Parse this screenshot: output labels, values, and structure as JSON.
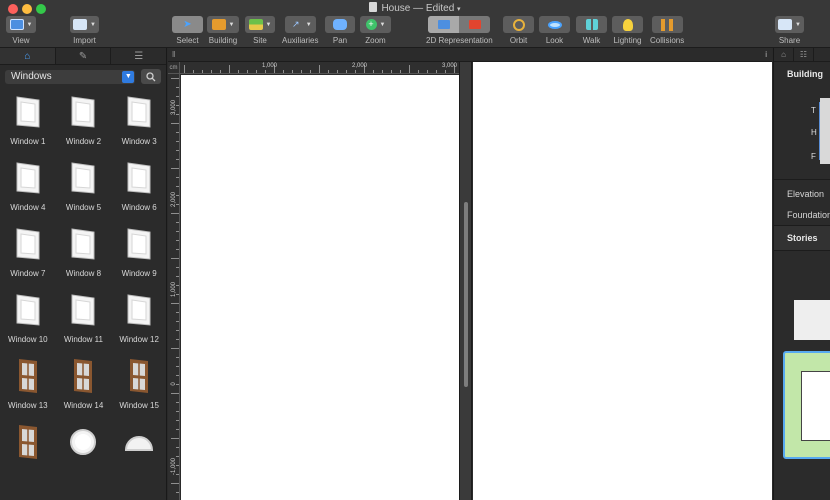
{
  "app": {
    "title": "House — Edited",
    "colors": {
      "close": "#fc605c",
      "minimize": "#fdbc40",
      "zoom": "#34c84a",
      "accent": "#2f7be0",
      "selection": "#57a9f0"
    }
  },
  "toolbar": {
    "view_label": "View",
    "import_label": "Import",
    "select_label": "Select",
    "building_label": "Building",
    "site_label": "Site",
    "auxiliaries_label": "Auxiliaries",
    "pan_label": "Pan",
    "zoom_label": "Zoom",
    "representation_label": "2D Representation",
    "orbit_label": "Orbit",
    "look_label": "Look",
    "walk_label": "Walk",
    "lighting_label": "Lighting",
    "collisions_label": "Collisions",
    "share_label": "Share"
  },
  "library": {
    "category": "Windows",
    "items": [
      {
        "label": "Window 1",
        "icon": "window-icon"
      },
      {
        "label": "Window 2",
        "icon": "window-icon"
      },
      {
        "label": "Window 3",
        "icon": "window-icon"
      },
      {
        "label": "Window 4",
        "icon": "window-icon"
      },
      {
        "label": "Window 5",
        "icon": "window-icon"
      },
      {
        "label": "Window 6",
        "icon": "window-icon"
      },
      {
        "label": "Window 7",
        "icon": "window-icon"
      },
      {
        "label": "Window 8",
        "icon": "window-icon"
      },
      {
        "label": "Window 9",
        "icon": "window-icon"
      },
      {
        "label": "Window 10",
        "icon": "window-icon"
      },
      {
        "label": "Window 11",
        "icon": "window-icon"
      },
      {
        "label": "Window 12",
        "icon": "window-icon"
      },
      {
        "label": "Window 13",
        "icon": "wood-window-icon"
      },
      {
        "label": "Window 14",
        "icon": "wood-window-icon"
      },
      {
        "label": "Window 15",
        "icon": "wood-window-icon"
      },
      {
        "label": "",
        "icon": "wood-window-icon"
      },
      {
        "label": "",
        "icon": "round-window-icon"
      },
      {
        "label": "",
        "icon": "half-round-window-icon"
      }
    ]
  },
  "ruler": {
    "unit": "cm",
    "top_labels": [
      "1,000",
      "2,000",
      "3,000"
    ],
    "left_labels": [
      "3,000",
      "2,000",
      "1,000",
      "0",
      "-1,000"
    ]
  },
  "inspector": {
    "heading": "Building",
    "level_letters": [
      "T",
      "H",
      "F"
    ],
    "elevation_label": "Elevation",
    "foundation_label": "Foundation",
    "stories_label": "Stories"
  }
}
